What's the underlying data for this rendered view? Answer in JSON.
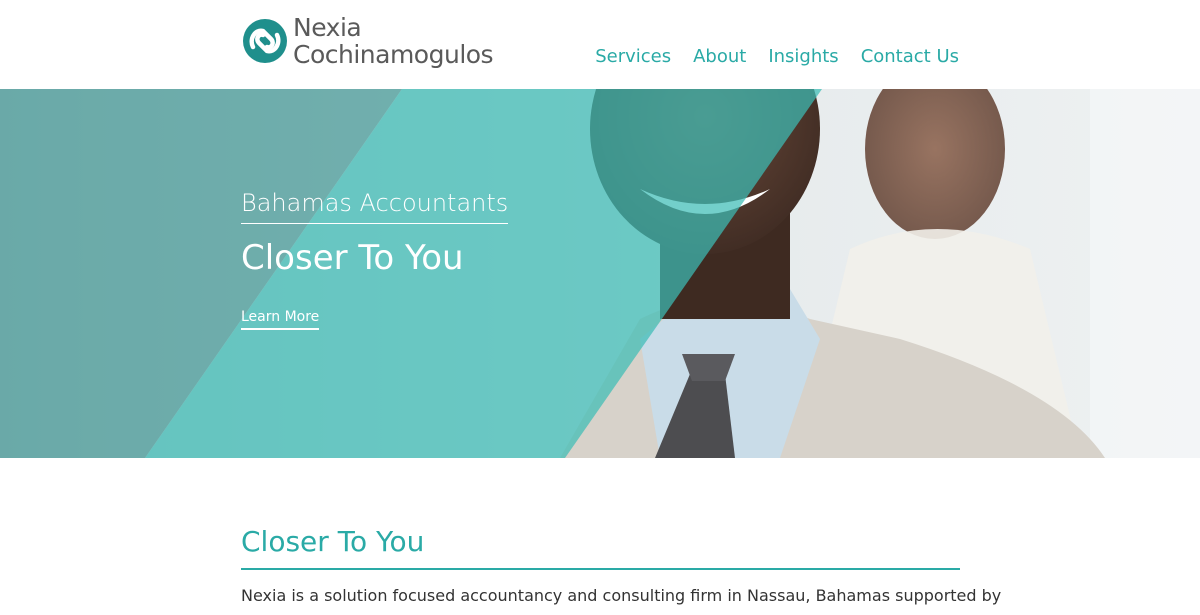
{
  "brand": {
    "name_line1": "Nexia",
    "name_line2": "Cochinamogulos",
    "logo_icon": "interlocking-rings-icon",
    "accent_color": "#2aaaa6",
    "logo_color": "#1f8f8c"
  },
  "nav": {
    "items": [
      {
        "label": "Services"
      },
      {
        "label": "About"
      },
      {
        "label": "Insights"
      },
      {
        "label": "Contact Us"
      }
    ]
  },
  "hero": {
    "subtitle": "Bahamas Accountants",
    "title": "Closer To You",
    "link_label": "Learn More"
  },
  "main": {
    "heading": "Closer To You",
    "intro": "Nexia is a solution focused accountancy and consulting firm in Nassau, Bahamas supported by"
  }
}
